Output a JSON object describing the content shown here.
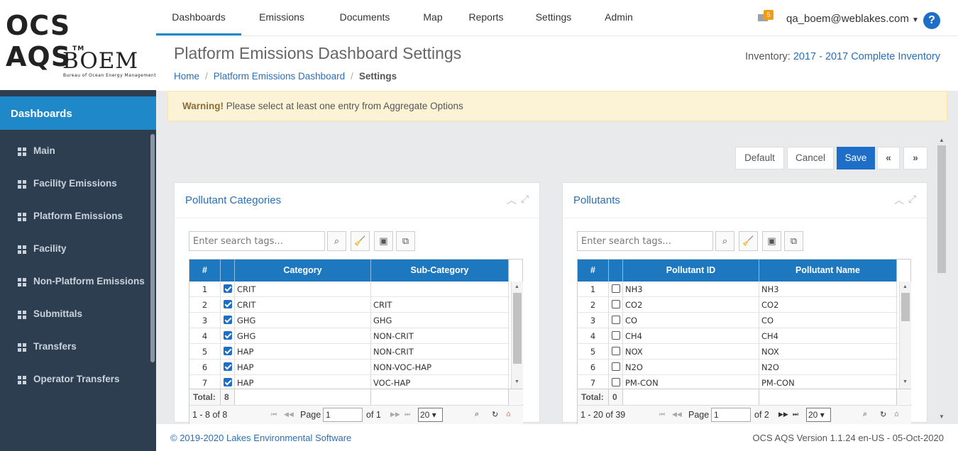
{
  "logo": {
    "title": "OCS AQS",
    "tm": "TM",
    "agency": "BOEM",
    "agency_full": "Bureau of Ocean Energy Management"
  },
  "nav": {
    "tabs": [
      "Dashboards",
      "Emissions",
      "Documents",
      "Map",
      "Reports",
      "Settings",
      "Admin"
    ],
    "active": "Dashboards",
    "mail_count": "5",
    "user": "qa_boem@weblakes.com",
    "help": "?"
  },
  "sidebar": {
    "header": "Dashboards",
    "items": [
      "Main",
      "Facility Emissions",
      "Platform Emissions",
      "Facility",
      "Non-Platform Emissions",
      "Submittals",
      "Transfers",
      "Operator Transfers"
    ]
  },
  "header": {
    "title": "Platform Emissions Dashboard Settings",
    "breadcrumb": [
      "Home",
      "Platform Emissions Dashboard",
      "Settings"
    ],
    "inventory_label": "Inventory:",
    "inventory_value": "2017 - 2017 Complete Inventory"
  },
  "warning": {
    "strong": "Warning!",
    "text": "Please select at least one entry from Aggregate Options"
  },
  "buttons": {
    "default": "Default",
    "cancel": "Cancel",
    "save": "Save",
    "collapse": "⌃",
    "expand": "⌄"
  },
  "panels": {
    "categories": {
      "title": "Pollutant Categories",
      "search_placeholder": "Enter search tags...",
      "columns": [
        "#",
        "",
        "Category",
        "Sub-Category"
      ],
      "rows": [
        {
          "n": "1",
          "checked": true,
          "a": "CRIT",
          "b": ""
        },
        {
          "n": "2",
          "checked": true,
          "a": "CRIT",
          "b": "CRIT"
        },
        {
          "n": "3",
          "checked": true,
          "a": "GHG",
          "b": "GHG"
        },
        {
          "n": "4",
          "checked": true,
          "a": "GHG",
          "b": "NON-CRIT"
        },
        {
          "n": "5",
          "checked": true,
          "a": "HAP",
          "b": "NON-CRIT"
        },
        {
          "n": "6",
          "checked": true,
          "a": "HAP",
          "b": "NON-VOC-HAP"
        },
        {
          "n": "7",
          "checked": true,
          "a": "HAP",
          "b": "VOC-HAP"
        }
      ],
      "total_label": "Total:",
      "total": "8",
      "range": "1 - 8 of 8",
      "page_label": "Page",
      "page": "1",
      "of": "of 1",
      "page_size": "20"
    },
    "pollutants": {
      "title": "Pollutants",
      "search_placeholder": "Enter search tags...",
      "columns": [
        "#",
        "",
        "Pollutant ID",
        "Pollutant Name"
      ],
      "rows": [
        {
          "n": "1",
          "checked": false,
          "a": "NH3",
          "b": "NH3"
        },
        {
          "n": "2",
          "checked": false,
          "a": "CO2",
          "b": "CO2"
        },
        {
          "n": "3",
          "checked": false,
          "a": "CO",
          "b": "CO"
        },
        {
          "n": "4",
          "checked": false,
          "a": "CH4",
          "b": "CH4"
        },
        {
          "n": "5",
          "checked": false,
          "a": "NOX",
          "b": "NOX"
        },
        {
          "n": "6",
          "checked": false,
          "a": "N2O",
          "b": "N2O"
        },
        {
          "n": "7",
          "checked": false,
          "a": "PM-CON",
          "b": "PM-CON"
        }
      ],
      "total_label": "Total:",
      "total": "0",
      "range": "1 - 20 of 39",
      "page_label": "Page",
      "page": "1",
      "of": "of 2",
      "page_size": "20"
    }
  },
  "footer": {
    "copyright": "© 2019-2020 Lakes Environmental Software",
    "version": "OCS AQS Version 1.1.24 en-US - 05-Oct-2020"
  },
  "colors": {
    "accent": "#1e88c8",
    "primary": "#1e6ec8",
    "sidebar": "#2d3e50",
    "warning_bg": "#fcf3d6",
    "grid_header": "#1e78c0"
  }
}
